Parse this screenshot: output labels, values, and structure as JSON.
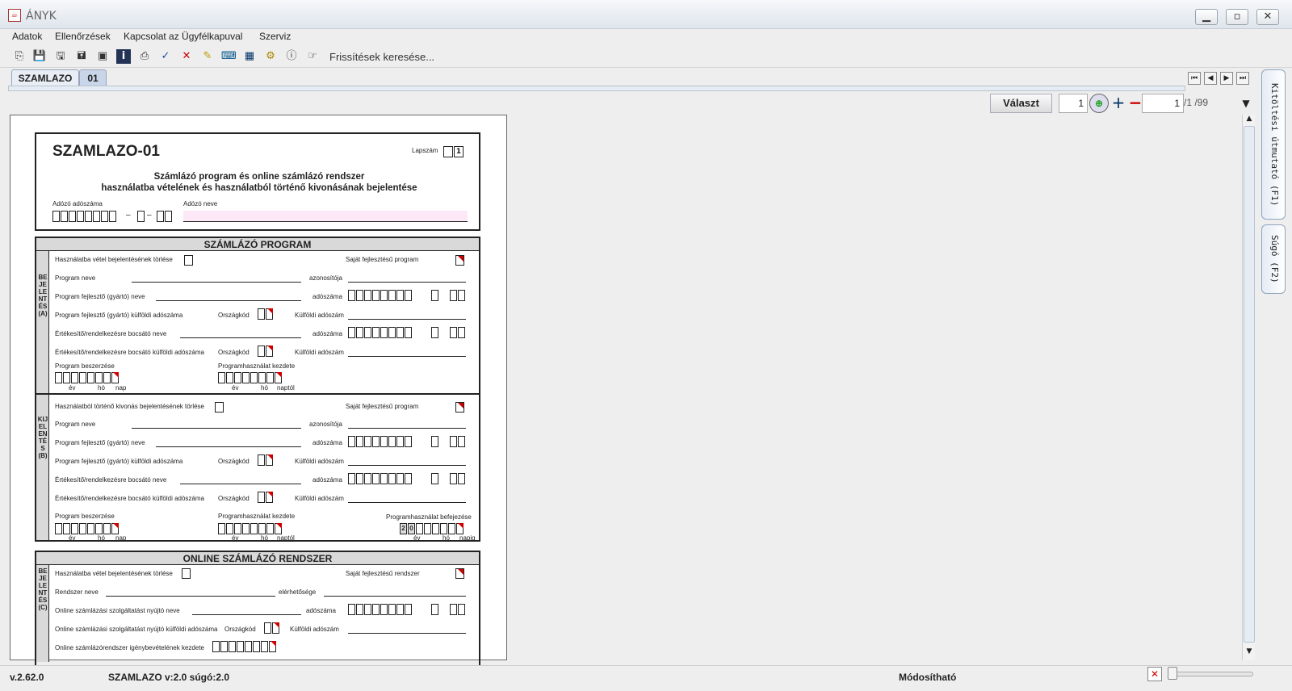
{
  "window": {
    "title": "ÁNYK",
    "icon": "java-cup-icon"
  },
  "menu": [
    "Adatok",
    "Ellenőrzések",
    "Kapcsolat az Ügyfélkapuval",
    "Szerviz"
  ],
  "toolbar": {
    "update_text": "Frissítések keresése..."
  },
  "tabs": [
    "SZAMLAZO",
    "01"
  ],
  "form_toolbar": {
    "select_label": "Választ",
    "page_value": "1",
    "page_of": "1",
    "page_total": "/1 /99"
  },
  "side_tabs": [
    "Kitöltési útmutató (F1)",
    "Súgó (F2)"
  ],
  "status": {
    "version": "v.2.62.0",
    "form_info": "SZAMLAZO v:2.0 súgó:2.0",
    "mode": "Módosítható"
  },
  "form": {
    "code": "SZAMLAZO-01",
    "page_label": "Lapszám",
    "page_number": "1",
    "title_line1": "Számlázó program és online számlázó rendszer",
    "title_line2": "használatba vételének és használatból történő kivonásának bejelentése",
    "taxpayer_id_label": "Adózó adószáma",
    "taxpayer_name_label": "Adózó neve",
    "section1_title": "SZÁMLÁZÓ PROGRAM",
    "section2_title": "ONLINE SZÁMLÁZÓ RENDSZER",
    "side_a": "BEJELENTÉS (A)",
    "side_b": "KIJELENTÉS (B)",
    "side_c": "BEJELENTÉS (C)",
    "labels": {
      "a_cancel": "Használatba vétel bejelentésének törlése",
      "own_program": "Saját fejlesztésű program",
      "program_name": "Program neve",
      "identifier": "azonosítója",
      "developer_name": "Program fejlesztő (gyártó) neve",
      "tax_number": "adószáma",
      "developer_foreign": "Program fejlesztő (gyártó) külföldi adószáma",
      "country_code": "Országkód",
      "foreign_tax": "Külföldi adószám",
      "seller_name": "Értékesítő/rendelkezésre bocsátó neve",
      "seller_foreign": "Értékesítő/rendelkezésre bocsátó külföldi adószáma",
      "procurement": "Program beszerzése",
      "usage_start": "Programhasználat kezdete",
      "usage_end": "Programhasználat befejezése",
      "b_cancel": "Használatból történő kivonás bejelentésének törlése",
      "year": "év",
      "month": "hó",
      "day": "nap",
      "from_day": "naptól",
      "to_day": "napig",
      "year_prefix_2": "2",
      "year_prefix_0": "0",
      "c_cancel": "Használatba vétel bejelentésének törlése",
      "own_system": "Saját fejlesztésű rendszer",
      "system_name": "Rendszer neve",
      "availability": "elérhetősége",
      "online_provider": "Online számlázási szolgáltatást nyújtó neve",
      "online_provider_foreign": "Online számlázási szolgáltatást nyújtó külföldi adószáma",
      "online_start": "Online számlázórendszer igénybevételének kezdete"
    }
  }
}
